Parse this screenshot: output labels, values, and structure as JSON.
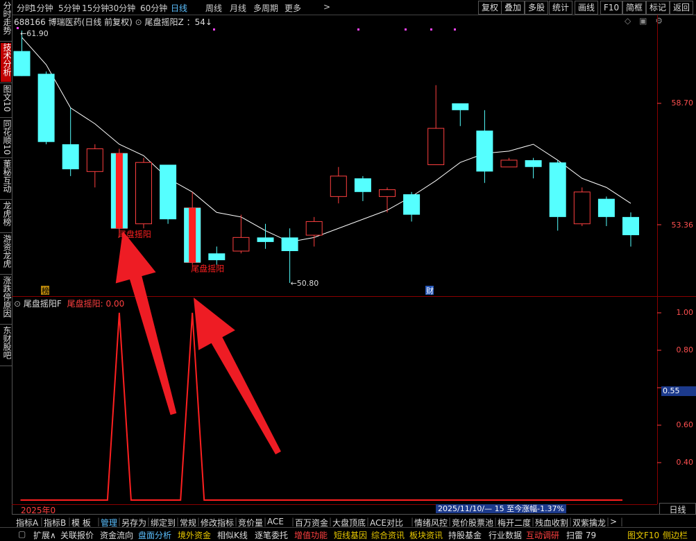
{
  "top_tabs": [
    "分时",
    "1分钟",
    "5分钟",
    "15分钟",
    "30分钟",
    "60分钟",
    "日线",
    "周线",
    "月线",
    "多周期",
    "更多"
  ],
  "top_active": "日线",
  "top_buttons": [
    "复权",
    "叠加",
    "多股",
    "统计",
    "画线",
    "F10",
    "简框",
    "标记",
    "返回"
  ],
  "sidebar": [
    "分时走势",
    "技术分析",
    "图文10",
    "同花顺10",
    "董秘互动",
    "龙虎榜",
    "游资龙虎",
    "涨跌停原因",
    "东财股吧"
  ],
  "sidebar_active": "技术分析",
  "k_header": {
    "code": "688166",
    "name": "博瑞医药(日线 前复权)",
    "indicator": "尾盘摇阳Z",
    "value": "54"
  },
  "high_label": "61.90",
  "low_label": "50.80",
  "price_axis": [
    "58.70",
    "53.36"
  ],
  "signal_label": "尾盘摇阳",
  "markers": {
    "bang": "榜",
    "cai": "财"
  },
  "sub_header": {
    "name": "尾盘摇阳F",
    "series": "尾盘摇阳",
    "value": "0.00"
  },
  "sub_axis": [
    "1.00",
    "0.80",
    "0.60",
    "0.40",
    "0.20"
  ],
  "sub_cursor": "0.55",
  "year_label": "2025年0",
  "range_info": "2025/11/10/— 15 至今涨幅-1.37%",
  "period_box": "日线",
  "bottom_tabs1": [
    "指标A",
    "指标B",
    "模 板",
    "管理",
    "另存为",
    "绑定到",
    "常规",
    "修改指标",
    "竞价量",
    "ACE",
    "百万资金",
    "大盘顶底",
    "ACE对比",
    "情绪风控",
    "竞价股票池",
    "梅开二度",
    "残血收割",
    "双紫擒龙",
    ">"
  ],
  "bottom_tabs1_active": "管理",
  "bottom_tabs2": [
    {
      "label": "扩展∧",
      "color": "#dddddd"
    },
    {
      "label": "关联报价",
      "color": "#dddddd"
    },
    {
      "label": "资金流向",
      "color": "#dddddd"
    },
    {
      "label": "盘面分析",
      "color": "#5cc0ff"
    },
    {
      "label": "境外资金",
      "color": "#e8c800"
    },
    {
      "label": "相似K线",
      "color": "#dddddd"
    },
    {
      "label": "逐笔委托",
      "color": "#dddddd"
    },
    {
      "label": "增值功能",
      "color": "#ff4040"
    },
    {
      "label": "短线基因",
      "color": "#e8c800"
    },
    {
      "label": "综合资讯",
      "color": "#e8c800"
    },
    {
      "label": "板块资讯",
      "color": "#e8c800"
    },
    {
      "label": "持股基金",
      "color": "#dddddd"
    },
    {
      "label": "行业数据",
      "color": "#dddddd"
    },
    {
      "label": "互动调研",
      "color": "#ff4040"
    },
    {
      "label": "扫雷 79",
      "color": "#dddddd"
    },
    {
      "label": "图文F10",
      "color": "#e8c800"
    },
    {
      "label": "侧边栏",
      "color": "#e8c800"
    }
  ],
  "colors": {
    "up": "#ff4040",
    "down": "#55ffff",
    "ma": "#ffffff",
    "signal": "#ff2020",
    "arrow": "#ee1c24",
    "grid": "#8b0000"
  },
  "chart_data": {
    "type": "candlestick",
    "price_axis_ticks": [
      58.7,
      53.36
    ],
    "high": 61.9,
    "low": 50.8,
    "candles": [
      {
        "open": 61.0,
        "close": 59.9,
        "high": 61.9,
        "low": 59.9
      },
      {
        "open": 60.0,
        "close": 57.0,
        "high": 60.1,
        "low": 56.9
      },
      {
        "open": 56.9,
        "close": 55.8,
        "high": 58.5,
        "low": 55.5
      },
      {
        "open": 55.7,
        "close": 56.7,
        "high": 56.9,
        "low": 55.0
      },
      {
        "open": 53.2,
        "close": 56.5,
        "high": 56.7,
        "low": 52.8,
        "signal": true
      },
      {
        "open": 53.4,
        "close": 56.1,
        "high": 56.3,
        "low": 53.2
      },
      {
        "open": 56.0,
        "close": 53.6,
        "high": 56.0,
        "low": 53.4
      },
      {
        "open": 51.7,
        "close": 54.1,
        "high": 54.8,
        "low": 51.6,
        "signal": true
      },
      {
        "open": 52.1,
        "close": 51.8,
        "high": 52.4,
        "low": 51.6
      },
      {
        "open": 52.2,
        "close": 52.8,
        "high": 53.8,
        "low": 52.1
      },
      {
        "open": 52.8,
        "close": 52.6,
        "high": 53.4,
        "low": 52.3
      },
      {
        "open": 52.8,
        "close": 52.2,
        "high": 53.2,
        "low": 50.8
      },
      {
        "open": 52.9,
        "close": 53.5,
        "high": 53.7,
        "low": 52.4
      },
      {
        "open": 54.6,
        "close": 55.5,
        "high": 55.9,
        "low": 54.3
      },
      {
        "open": 55.4,
        "close": 54.8,
        "high": 55.5,
        "low": 54.4
      },
      {
        "open": 54.6,
        "close": 54.9,
        "high": 55.0,
        "low": 53.9
      },
      {
        "open": 54.7,
        "close": 53.8,
        "high": 54.8,
        "low": 53.5
      },
      {
        "open": 56.0,
        "close": 57.6,
        "high": 59.5,
        "low": 56.0
      },
      {
        "open": 58.7,
        "close": 58.4,
        "high": 58.7,
        "low": 57.7
      },
      {
        "open": 57.5,
        "close": 55.7,
        "high": 58.4,
        "low": 55.2
      },
      {
        "open": 55.9,
        "close": 56.2,
        "high": 56.3,
        "low": 55.9
      },
      {
        "open": 56.2,
        "close": 55.9,
        "high": 56.3,
        "low": 55.4
      },
      {
        "open": 56.1,
        "close": 53.7,
        "high": 56.2,
        "low": 53.1
      },
      {
        "open": 53.4,
        "close": 54.8,
        "high": 55.0,
        "low": 53.3
      },
      {
        "open": 54.5,
        "close": 53.7,
        "high": 54.6,
        "low": 53.3
      },
      {
        "open": 53.7,
        "close": 52.9,
        "high": 53.9,
        "low": 52.4
      }
    ],
    "ma": [
      61.6,
      60.4,
      58.5,
      57.8,
      56.9,
      56.4,
      55.4,
      54.8,
      53.9,
      53.7,
      53.1,
      52.6,
      52.8,
      53.2,
      53.6,
      54.0,
      54.6,
      55.3,
      56.1,
      56.5,
      56.6,
      56.9,
      56.2,
      55.4,
      55.0,
      54.3
    ],
    "sub_series": {
      "name": "尾盘摇阳",
      "values": [
        0,
        0,
        0,
        0,
        1,
        0,
        0,
        1,
        0,
        0,
        0,
        0,
        0,
        0,
        0,
        0,
        0,
        0,
        0,
        0,
        0,
        0,
        0,
        0,
        0,
        0
      ]
    }
  }
}
